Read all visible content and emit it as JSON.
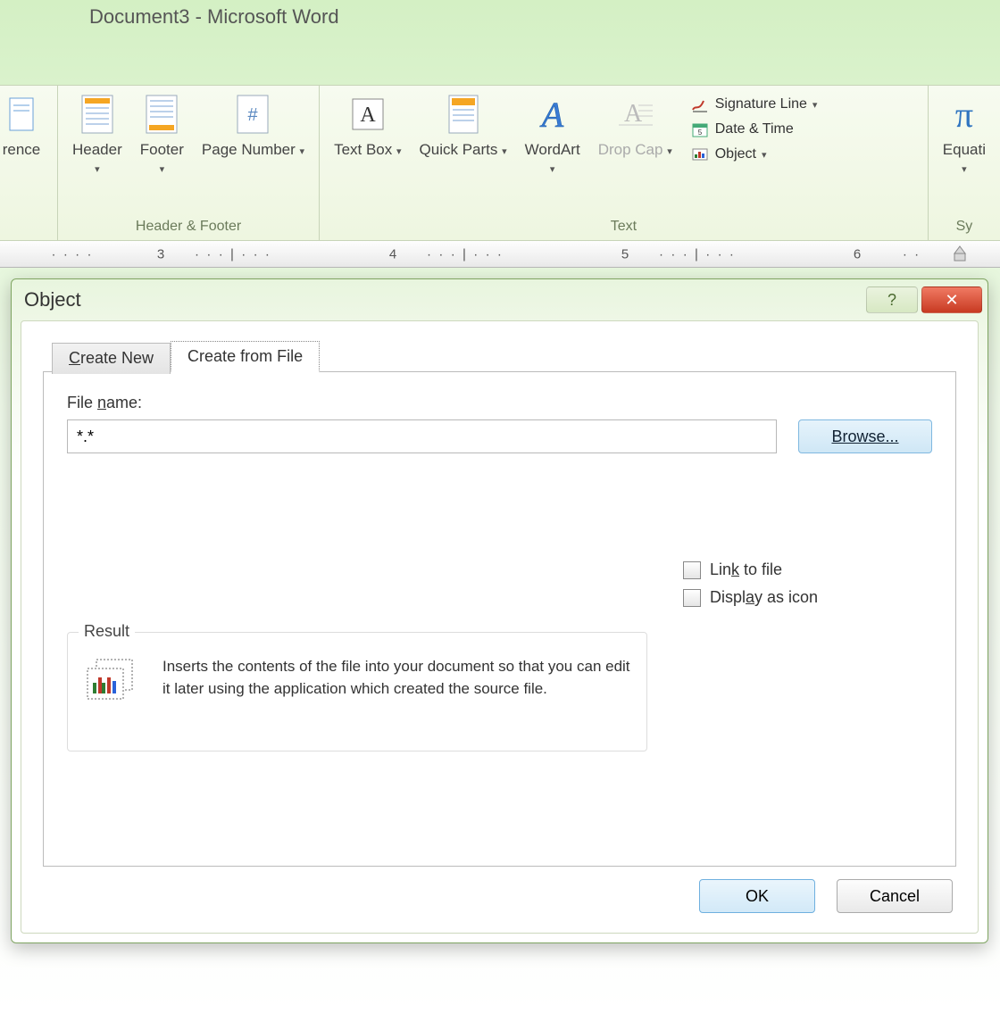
{
  "window": {
    "title": "Document3 - Microsoft Word"
  },
  "ribbon": {
    "partial_left": "rence",
    "groups": {
      "header_footer": {
        "label": "Header & Footer",
        "header": "Header",
        "footer": "Footer",
        "page_number": "Page Number"
      },
      "text": {
        "label": "Text",
        "text_box": "Text Box",
        "quick_parts": "Quick Parts",
        "wordart": "WordArt",
        "drop_cap": "Drop Cap",
        "signature_line": "Signature Line",
        "date_time": "Date & Time",
        "object": "Object"
      },
      "symbols": {
        "label": "Sy",
        "equation": "Equati"
      }
    }
  },
  "ruler": {
    "marks": [
      "3",
      "4",
      "5",
      "6"
    ]
  },
  "dialog": {
    "title": "Object",
    "tabs": {
      "create_new": "Create New",
      "create_from_file": "Create from File"
    },
    "file_name_label": "File name:",
    "file_name_value": "*.*",
    "browse": "Browse...",
    "link_to_file": "Link to file",
    "display_as_icon": "Display as icon",
    "result_legend": "Result",
    "result_text": "Inserts the contents of the file into your document so that you can edit it later using the application which created the source file.",
    "ok": "OK",
    "cancel": "Cancel"
  }
}
